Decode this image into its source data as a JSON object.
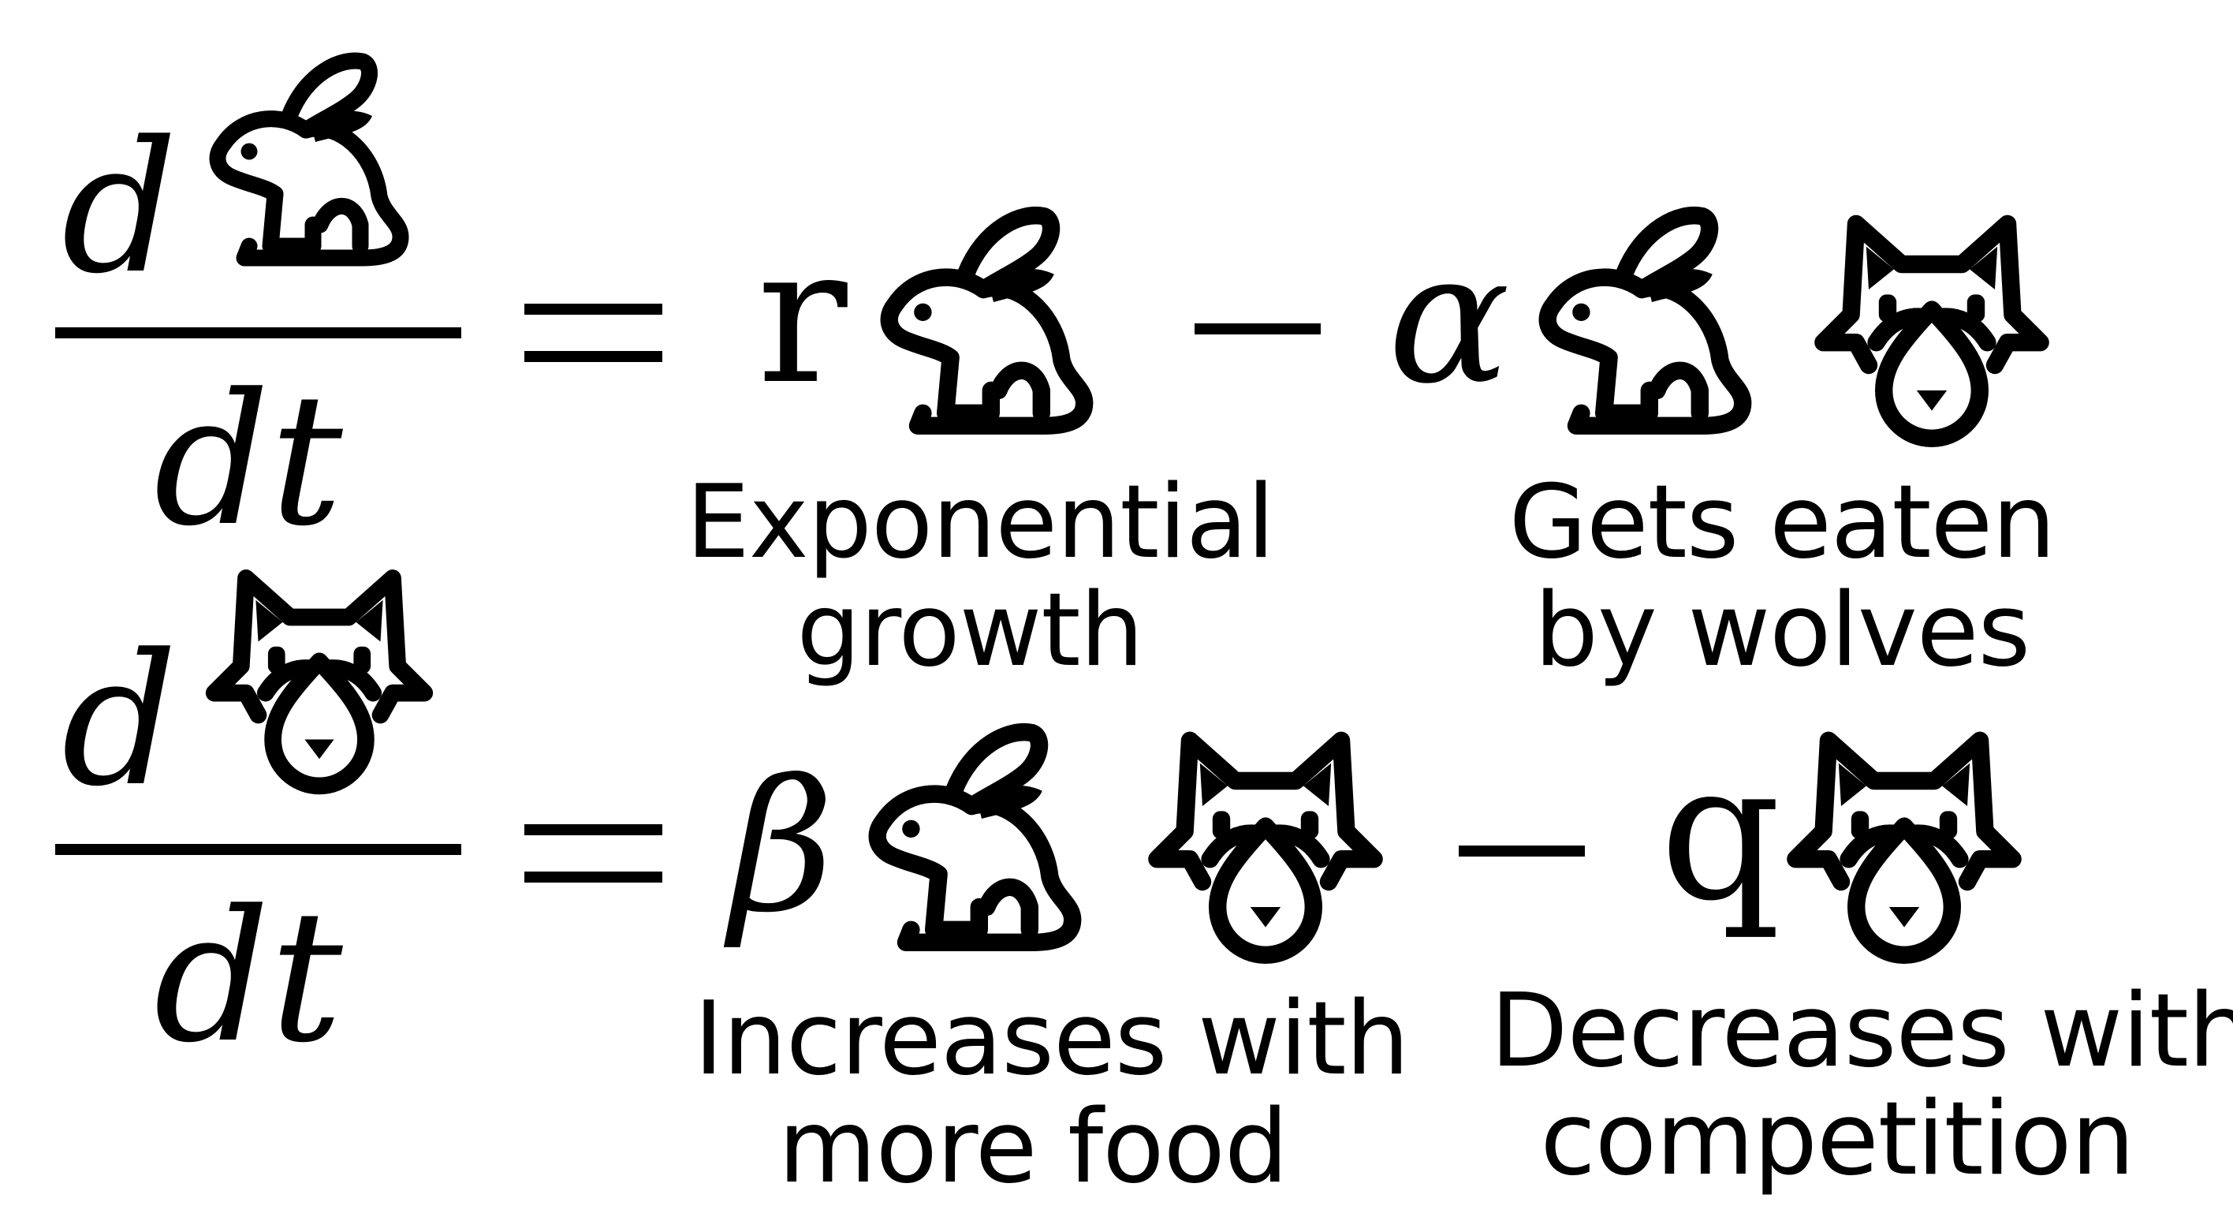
{
  "equation_1": {
    "numerator_d": "d",
    "denominator": "dt",
    "equals": "=",
    "term1_coeff": "r",
    "term1_caption": [
      "Exponential",
      "growth"
    ],
    "minus": "−",
    "term2_coeff": "α",
    "term2_caption": [
      "Gets eaten",
      "by wolves"
    ]
  },
  "equation_2": {
    "numerator_d": "d",
    "denominator": "dt",
    "equals": "=",
    "term1_coeff": "β",
    "term1_caption": [
      "Increases with",
      "more food"
    ],
    "minus": "−",
    "term2_coeff": "q",
    "term2_caption": [
      "Decreases with",
      "competition"
    ]
  },
  "icons": {
    "prey": "rabbit-icon",
    "predator": "wolf-icon"
  },
  "colors": {
    "ink": "#000000",
    "background": "#ffffff"
  }
}
